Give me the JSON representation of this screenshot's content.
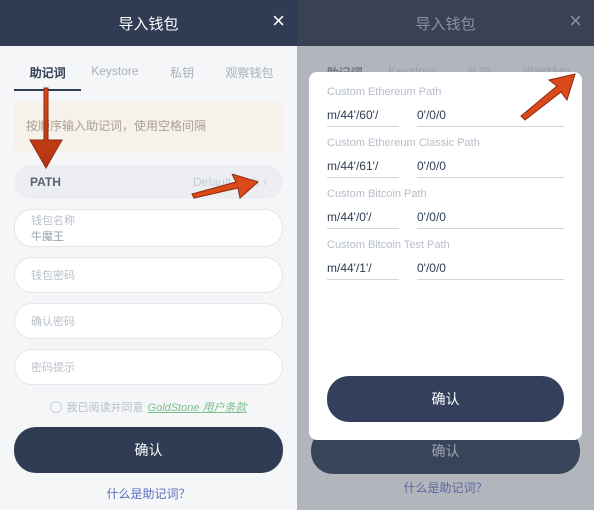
{
  "left": {
    "header": {
      "title": "导入钱包",
      "close": "×"
    },
    "tabs": [
      {
        "label": "助记词",
        "active": true
      },
      {
        "label": "Keystore",
        "active": false
      },
      {
        "label": "私钥",
        "active": false
      },
      {
        "label": "观察钱包",
        "active": false
      }
    ],
    "mnemonic_placeholder": "按顺序输入助记词，使用空格间隔",
    "path_row": {
      "label": "PATH",
      "value": "Default Path",
      "chev": "›"
    },
    "fields": {
      "name_label": "钱包名称",
      "name_value": "牛魔王",
      "pwd_label": "钱包密码",
      "pwd2_label": "确认密码",
      "hint_label": "密码提示"
    },
    "terms": {
      "prefix": "我已阅读并同意",
      "link": "GoldStone 用户条款"
    },
    "confirm": "确认",
    "bottom_link": "什么是助记词？"
  },
  "right": {
    "header": {
      "title": "导入钱包",
      "close": "×"
    },
    "tabs": [
      {
        "label": "助记词",
        "active": true
      },
      {
        "label": "Keystore",
        "active": false
      },
      {
        "label": "私钥",
        "active": false
      },
      {
        "label": "观察钱包",
        "active": false
      }
    ],
    "bg_confirm": "确认",
    "bottom_link": "什么是助记词？",
    "sheet": {
      "groups": [
        {
          "label": "Custom Ethereum Path",
          "p1": "m/44'/60'/",
          "p2": "0'/0/0"
        },
        {
          "label": "Custom Ethereum Classic Path",
          "p1": "m/44'/61'/",
          "p2": "0'/0/0"
        },
        {
          "label": "Custom Bitcoin Path",
          "p1": "m/44'/0'/",
          "p2": "0'/0/0"
        },
        {
          "label": "Custom Bitcoin Test Path",
          "p1": "m/44'/1'/",
          "p2": "0'/0/0"
        }
      ],
      "confirm": "确认"
    }
  },
  "colors": {
    "accent": "#2f3c54",
    "arrow": "#d9491a"
  }
}
